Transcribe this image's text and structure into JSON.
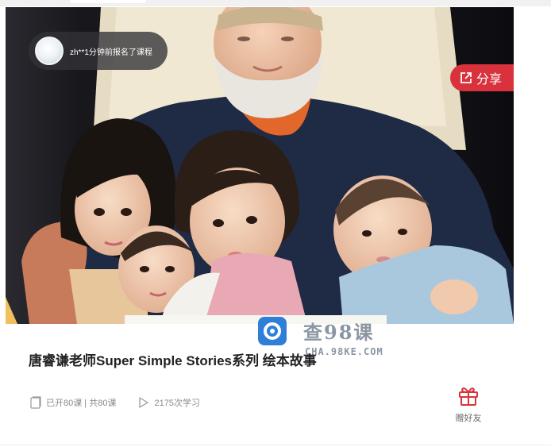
{
  "hero": {
    "enroll_notice": "zh**1分钟前报名了课程",
    "share_label": "分享"
  },
  "watermark": {
    "name": "查98课",
    "url": "CHA.98KE.COM"
  },
  "course": {
    "title": "唐睿谦老师Super Simple Stories系列 绘本故事",
    "lessons": "已开80课 | 共80课",
    "learners": "2175次学习"
  },
  "actions": {
    "gift_label": "赠好友"
  },
  "colors": {
    "share_red": "#d9323c",
    "watermark_blue": "#2f7fd8",
    "gift_red": "#d9323c",
    "meta_gray": "#8a8a8a"
  },
  "icons": {
    "share": "share-icon",
    "lessons": "document-icon",
    "learners": "play-icon",
    "gift": "gift-icon",
    "watermark_logo": "search-logo-icon"
  }
}
